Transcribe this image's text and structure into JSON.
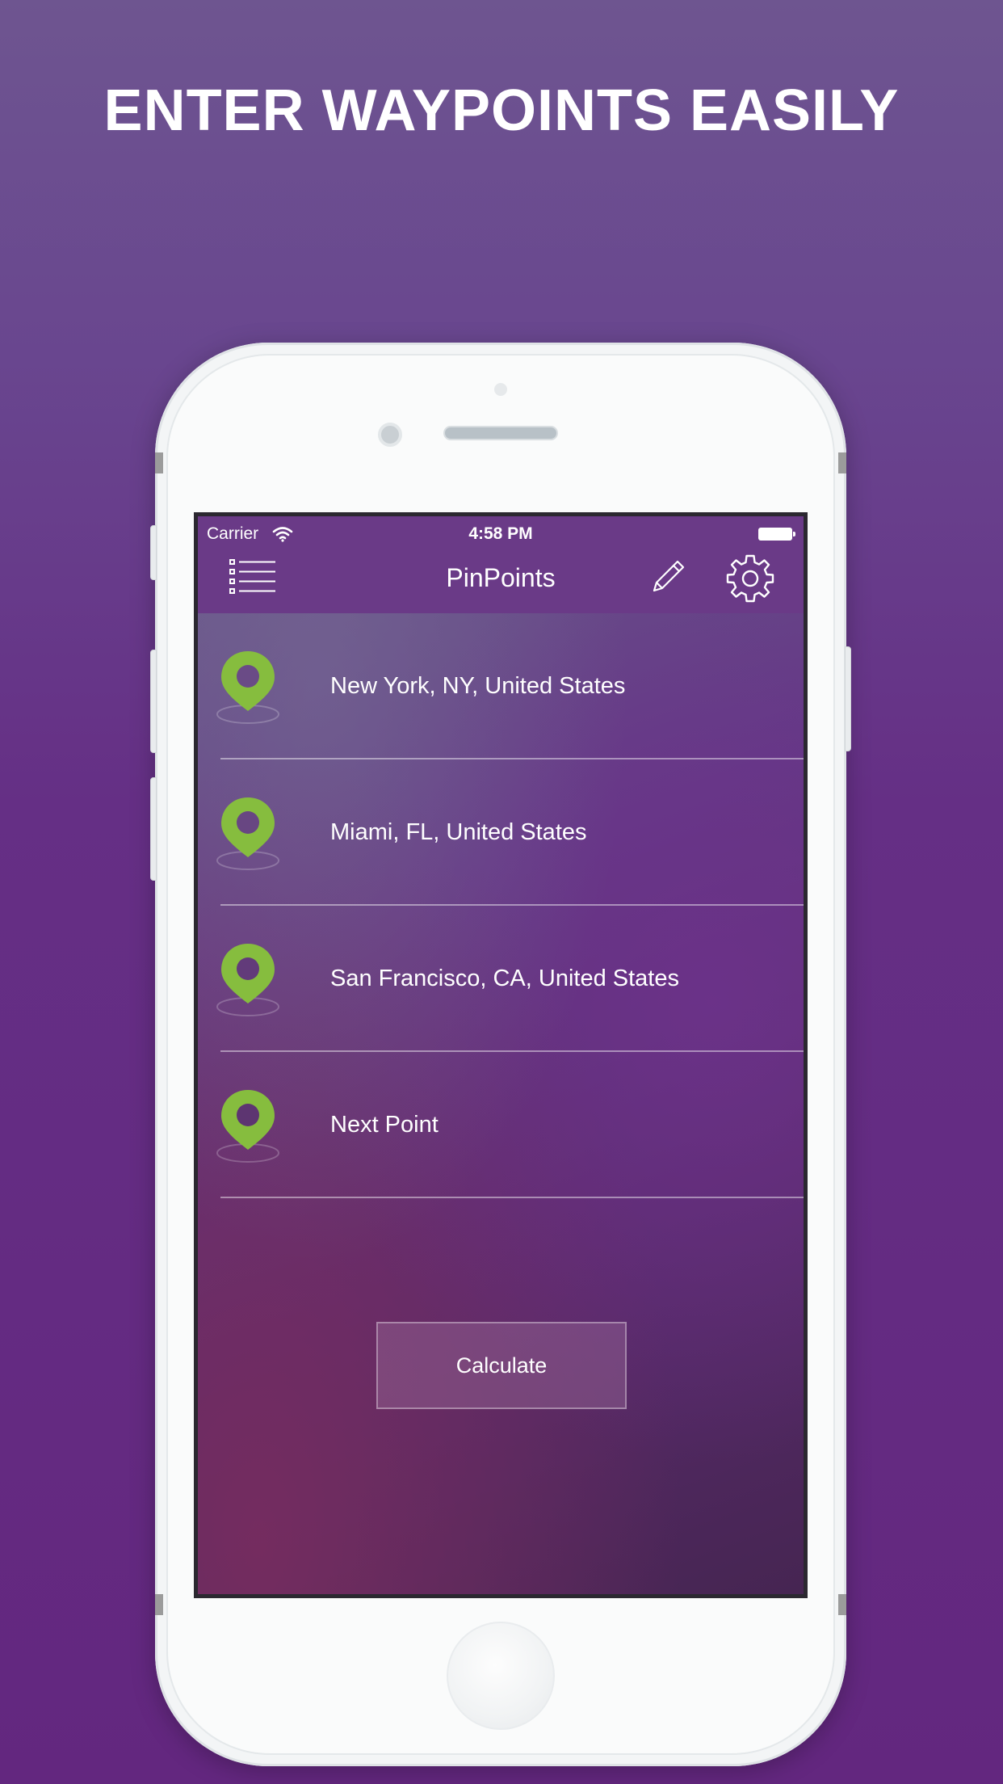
{
  "headline": "ENTER WAYPOINTS EASILY",
  "status_bar": {
    "carrier": "Carrier",
    "time": "4:58 PM"
  },
  "nav": {
    "title": "PinPoints",
    "left_icon": "list-menu-icon",
    "right_icons": [
      "pencil-icon",
      "gear-icon"
    ]
  },
  "waypoints": [
    {
      "label": "New York, NY, United States",
      "icon": "map-pin-icon"
    },
    {
      "label": "Miami, FL, United States",
      "icon": "map-pin-icon"
    },
    {
      "label": "San Francisco, CA, United States",
      "icon": "map-pin-icon"
    },
    {
      "label": "Next Point",
      "icon": "map-pin-icon"
    }
  ],
  "calculate_label": "Calculate",
  "colors": {
    "accent_green": "#86bd3e",
    "nav_purple": "#6a3a87",
    "background_purple": "#63277f"
  }
}
